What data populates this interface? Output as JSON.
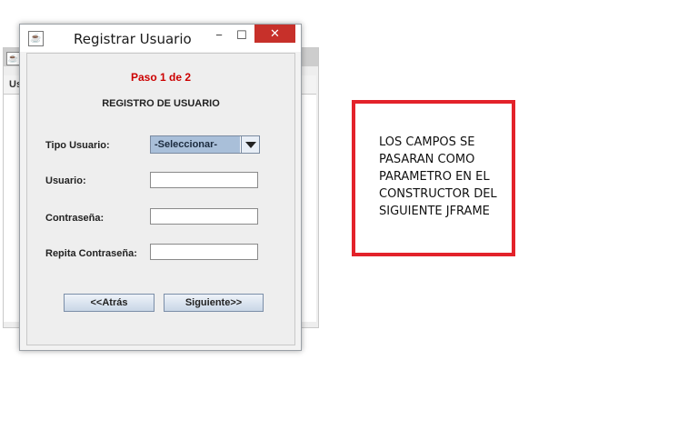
{
  "background_window": {
    "header_label": "Us"
  },
  "dialog": {
    "title": "Registrar Usuario",
    "window_controls": {
      "minimize": "−",
      "maximize": "☐",
      "close": "✕"
    },
    "step": "Paso 1 de 2",
    "heading": "REGISTRO DE USUARIO",
    "fields": {
      "tipo_usuario": {
        "label": "Tipo Usuario:",
        "value": "-Seleccionar-"
      },
      "usuario": {
        "label": "Usuario:",
        "value": ""
      },
      "contrasena": {
        "label": "Contraseña:",
        "value": ""
      },
      "repita_contrasena": {
        "label": "Repita Contraseña:",
        "value": ""
      }
    },
    "buttons": {
      "back": "<<Atrás",
      "next": "Siguiente>>"
    }
  },
  "annotation": {
    "text": "LOS CAMPOS SE\nPASARAN COMO\nPARAMETRO EN EL\nCONSTRUCTOR DEL\nSIGUIENTE JFRAME",
    "border_color": "#e3222a"
  },
  "colors": {
    "step_text": "#cc0000",
    "close_button": "#c7302a",
    "combo_highlight": "#a9bfd9"
  }
}
